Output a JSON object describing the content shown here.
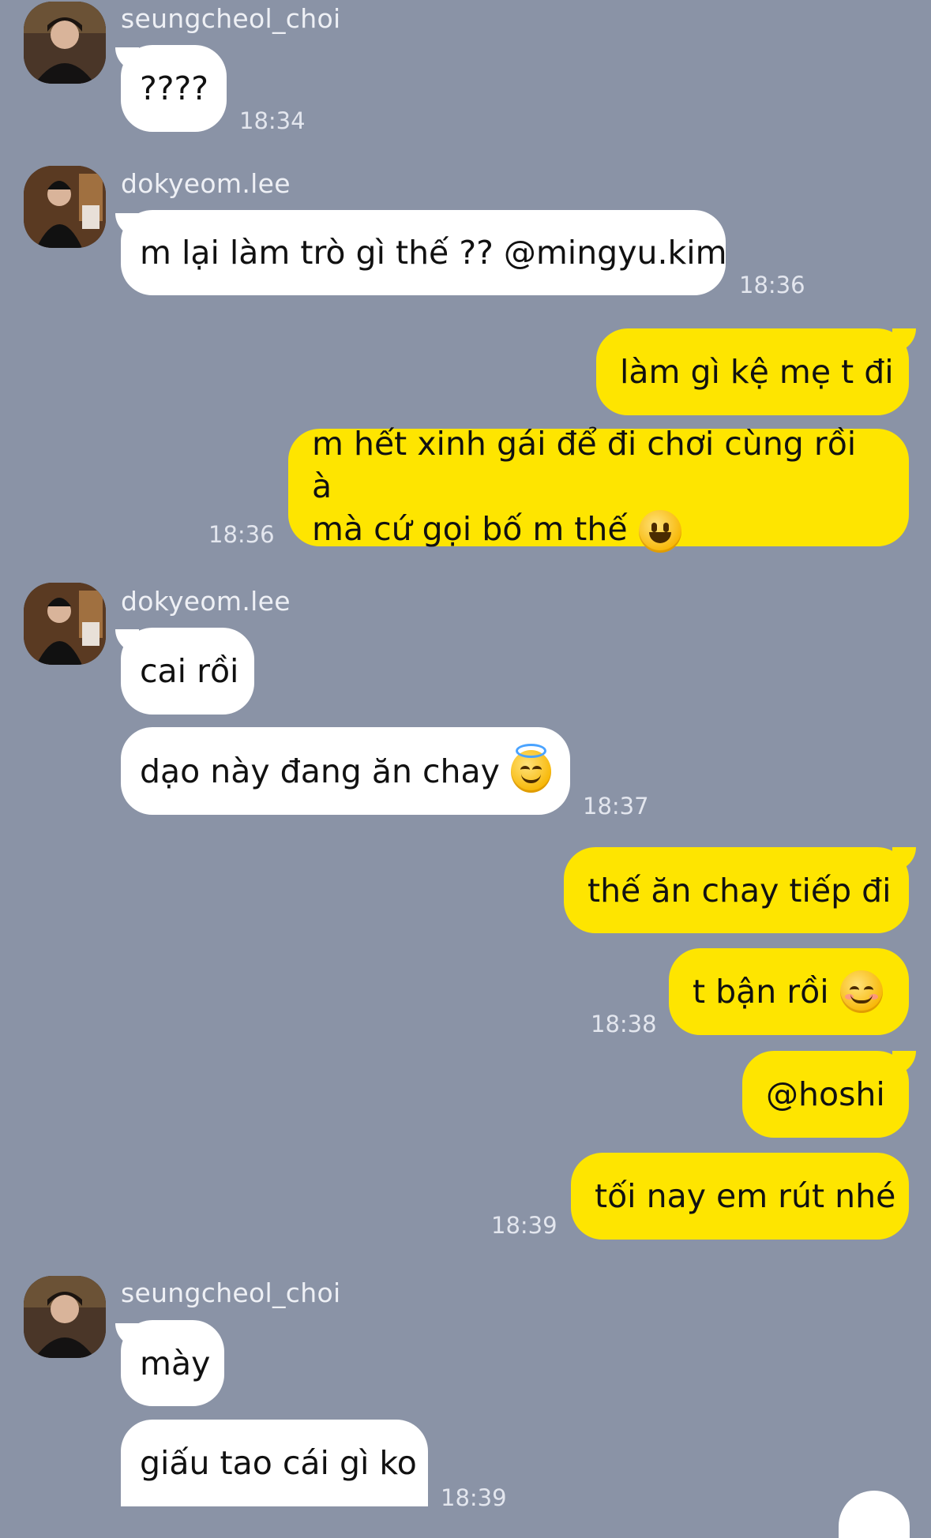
{
  "users": {
    "a": "seungcheol_choi",
    "b": "dokyeom.lee"
  },
  "messages": [
    {
      "text": "????",
      "time": "18:34"
    },
    {
      "text": "m lại làm trò gì thế ?? @mingyu.kim",
      "time": "18:36"
    },
    {
      "text": "làm gì kệ mẹ t đi"
    },
    {
      "line1": "m hết xinh gái để đi chơi cùng rồi à",
      "line2": "mà cứ gọi bố m thế",
      "emoji": "grinning-face",
      "time": "18:36"
    },
    {
      "text": "cai rồi"
    },
    {
      "text": "dạo này đang ăn chay",
      "emoji": "smiling-face-with-halo",
      "time": "18:37"
    },
    {
      "text": "thế ăn chay tiếp đi"
    },
    {
      "text": "t bận rồi",
      "emoji": "smiling-face",
      "time": "18:38"
    },
    {
      "text": "@hoshi"
    },
    {
      "text": "tối nay em rút nhé",
      "time": "18:39"
    },
    {
      "text": "mày"
    },
    {
      "text": "giấu tao cái gì ko",
      "time": "18:39"
    }
  ],
  "colors": {
    "background": "#8a93a6",
    "incoming_bubble": "#ffffff",
    "outgoing_bubble": "#fee500",
    "timestamp": "#e3e6ee"
  }
}
